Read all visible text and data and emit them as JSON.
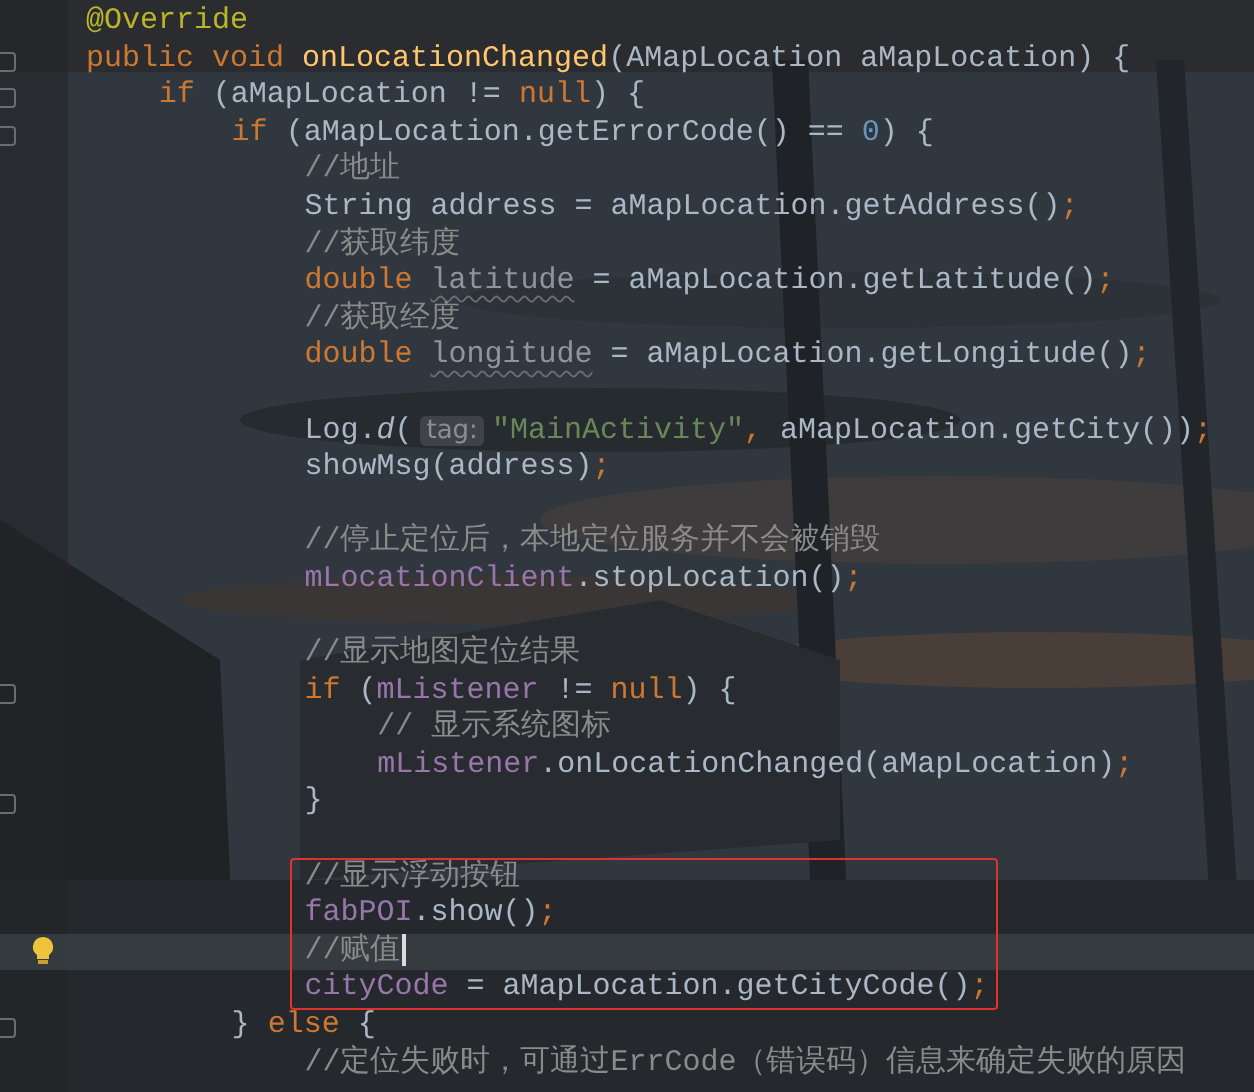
{
  "editor": {
    "lines": [
      {
        "kind": "code",
        "current": false,
        "fold": false,
        "tokens": [
          {
            "kind": "annotation",
            "text": "@Override"
          }
        ]
      },
      {
        "kind": "code",
        "current": false,
        "fold": true,
        "tokens": [
          {
            "kind": "keyword",
            "text": "public void "
          },
          {
            "kind": "declaration",
            "text": "onLocationChanged"
          },
          {
            "kind": "plain",
            "text": "(AMapLocation aMapLocation) {"
          }
        ],
        "children": [
          {
            "kind": "code",
            "current": false,
            "fold": true,
            "tokens": [
              {
                "kind": "keyword",
                "text": "if"
              },
              {
                "kind": "plain",
                "text": " (aMapLocation != "
              },
              {
                "kind": "keyword",
                "text": "null"
              },
              {
                "kind": "plain",
                "text": ") {"
              }
            ],
            "children": [
              {
                "kind": "code",
                "current": false,
                "fold": true,
                "tokens": [
                  {
                    "kind": "keyword",
                    "text": "if"
                  },
                  {
                    "kind": "plain",
                    "text": " (aMapLocation.getErrorCode() == "
                  },
                  {
                    "kind": "number",
                    "text": "0"
                  },
                  {
                    "kind": "plain",
                    "text": ") {"
                  }
                ],
                "children": [
                  {
                    "kind": "code",
                    "current": false,
                    "fold": false,
                    "tokens": [
                      {
                        "kind": "comment",
                        "text": "//地址"
                      }
                    ]
                  },
                  {
                    "kind": "code",
                    "current": false,
                    "fold": false,
                    "tokens": [
                      {
                        "kind": "plain",
                        "text": "String address = aMapLocation.getAddress()"
                      },
                      {
                        "kind": "keyword",
                        "text": ";"
                      }
                    ]
                  },
                  {
                    "kind": "code",
                    "current": false,
                    "fold": false,
                    "tokens": [
                      {
                        "kind": "comment",
                        "text": "//获取纬度"
                      }
                    ]
                  },
                  {
                    "kind": "code",
                    "current": false,
                    "fold": false,
                    "tokens": [
                      {
                        "kind": "keyword",
                        "text": "double "
                      },
                      {
                        "kind": "unused",
                        "text": "latitude"
                      },
                      {
                        "kind": "plain",
                        "text": " = aMapLocation.getLatitude()"
                      },
                      {
                        "kind": "keyword",
                        "text": ";"
                      }
                    ]
                  },
                  {
                    "kind": "code",
                    "current": false,
                    "fold": false,
                    "tokens": [
                      {
                        "kind": "comment",
                        "text": "//获取经度"
                      }
                    ]
                  },
                  {
                    "kind": "code",
                    "current": false,
                    "fold": false,
                    "tokens": [
                      {
                        "kind": "keyword",
                        "text": "double "
                      },
                      {
                        "kind": "unused",
                        "text": "longitude"
                      },
                      {
                        "kind": "plain",
                        "text": " = aMapLocation.getLongitude()"
                      },
                      {
                        "kind": "keyword",
                        "text": ";"
                      }
                    ]
                  },
                  {
                    "kind": "blank"
                  },
                  {
                    "kind": "code",
                    "current": false,
                    "fold": false,
                    "tokens": [
                      {
                        "kind": "plain",
                        "text": "Log."
                      },
                      {
                        "kind": "static",
                        "text": "d"
                      },
                      {
                        "kind": "plain",
                        "text": "("
                      },
                      {
                        "kind": "hint",
                        "text": "tag:"
                      },
                      {
                        "kind": "string",
                        "text": "\"MainActivity\""
                      },
                      {
                        "kind": "keyword",
                        "text": ","
                      },
                      {
                        "kind": "plain",
                        "text": " aMapLocation.getCity())"
                      },
                      {
                        "kind": "keyword",
                        "text": ";"
                      }
                    ]
                  },
                  {
                    "kind": "code",
                    "current": false,
                    "fold": false,
                    "tokens": [
                      {
                        "kind": "plain",
                        "text": "showMsg(address)"
                      },
                      {
                        "kind": "keyword",
                        "text": ";"
                      }
                    ]
                  },
                  {
                    "kind": "blank"
                  },
                  {
                    "kind": "code",
                    "current": false,
                    "fold": false,
                    "tokens": [
                      {
                        "kind": "comment",
                        "text": "//停止定位后，本地定位服务并不会被销毁"
                      }
                    ]
                  },
                  {
                    "kind": "code",
                    "current": false,
                    "fold": false,
                    "tokens": [
                      {
                        "kind": "field",
                        "text": "mLocationClient"
                      },
                      {
                        "kind": "plain",
                        "text": ".stopLocation()"
                      },
                      {
                        "kind": "keyword",
                        "text": ";"
                      }
                    ]
                  },
                  {
                    "kind": "blank"
                  },
                  {
                    "kind": "code",
                    "current": false,
                    "fold": false,
                    "tokens": [
                      {
                        "kind": "comment",
                        "text": "//显示地图定位结果"
                      }
                    ]
                  },
                  {
                    "kind": "code",
                    "current": false,
                    "fold": true,
                    "tokens": [
                      {
                        "kind": "keyword",
                        "text": "if"
                      },
                      {
                        "kind": "plain",
                        "text": " ("
                      },
                      {
                        "kind": "field",
                        "text": "mListener"
                      },
                      {
                        "kind": "plain",
                        "text": " != "
                      },
                      {
                        "kind": "keyword",
                        "text": "null"
                      },
                      {
                        "kind": "plain",
                        "text": ") {"
                      }
                    ],
                    "children": [
                      {
                        "kind": "code",
                        "current": false,
                        "fold": false,
                        "tokens": [
                          {
                            "kind": "comment",
                            "text": "// 显示系统图标"
                          }
                        ]
                      },
                      {
                        "kind": "code",
                        "current": false,
                        "fold": false,
                        "tokens": [
                          {
                            "kind": "field",
                            "text": "mListener"
                          },
                          {
                            "kind": "plain",
                            "text": ".onLocationChanged(aMapLocation)"
                          },
                          {
                            "kind": "keyword",
                            "text": ";"
                          }
                        ]
                      }
                    ]
                  },
                  {
                    "kind": "code",
                    "current": false,
                    "fold": true,
                    "tokens": [
                      {
                        "kind": "plain",
                        "text": "}"
                      }
                    ]
                  },
                  {
                    "kind": "blank"
                  },
                  {
                    "kind": "boxed",
                    "children": [
                      {
                        "kind": "code",
                        "current": false,
                        "fold": false,
                        "tokens": [
                          {
                            "kind": "comment",
                            "text": "//显示浮动按钮"
                          }
                        ]
                      },
                      {
                        "kind": "code",
                        "current": false,
                        "fold": false,
                        "tokens": [
                          {
                            "kind": "field",
                            "text": "fabPOI"
                          },
                          {
                            "kind": "plain",
                            "text": ".show()"
                          },
                          {
                            "kind": "keyword",
                            "text": ";"
                          }
                        ]
                      },
                      {
                        "kind": "code",
                        "current": true,
                        "fold": false,
                        "tokens": [
                          {
                            "kind": "comment",
                            "text": "//赋值"
                          }
                        ]
                      },
                      {
                        "kind": "code",
                        "current": false,
                        "fold": false,
                        "tokens": [
                          {
                            "kind": "field",
                            "text": "cityCode"
                          },
                          {
                            "kind": "plain",
                            "text": " = aMapLocation.getCityCode()"
                          },
                          {
                            "kind": "keyword",
                            "text": ";"
                          }
                        ]
                      }
                    ]
                  }
                ]
              },
              {
                "kind": "code",
                "current": false,
                "fold": true,
                "tokens": [
                  {
                    "kind": "plain",
                    "text": "} "
                  },
                  {
                    "kind": "keyword",
                    "text": "else"
                  },
                  {
                    "kind": "plain",
                    "text": " {"
                  }
                ],
                "children": [
                  {
                    "kind": "code",
                    "current": false,
                    "fold": false,
                    "tokens": [
                      {
                        "kind": "comment",
                        "text": "//定位失败时，可通过ErrCode（错误码）信息来确定失败的原因"
                      }
                    ]
                  }
                ]
              }
            ]
          }
        ]
      }
    ]
  }
}
